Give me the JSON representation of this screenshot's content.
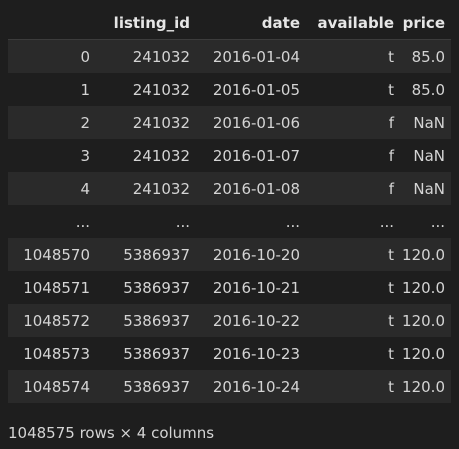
{
  "table": {
    "columns": [
      "",
      "listing_id",
      "date",
      "available",
      "price"
    ],
    "rows": [
      [
        "0",
        "241032",
        "2016-01-04",
        "t",
        "85.0"
      ],
      [
        "1",
        "241032",
        "2016-01-05",
        "t",
        "85.0"
      ],
      [
        "2",
        "241032",
        "2016-01-06",
        "f",
        "NaN"
      ],
      [
        "3",
        "241032",
        "2016-01-07",
        "f",
        "NaN"
      ],
      [
        "4",
        "241032",
        "2016-01-08",
        "f",
        "NaN"
      ],
      [
        "...",
        "...",
        "...",
        "...",
        "..."
      ],
      [
        "1048570",
        "5386937",
        "2016-10-20",
        "t",
        "120.0"
      ],
      [
        "1048571",
        "5386937",
        "2016-10-21",
        "t",
        "120.0"
      ],
      [
        "1048572",
        "5386937",
        "2016-10-22",
        "t",
        "120.0"
      ],
      [
        "1048573",
        "5386937",
        "2016-10-23",
        "t",
        "120.0"
      ],
      [
        "1048574",
        "5386937",
        "2016-10-24",
        "t",
        "120.0"
      ]
    ]
  },
  "footer": {
    "shape": "1048575 rows × 4 columns"
  }
}
